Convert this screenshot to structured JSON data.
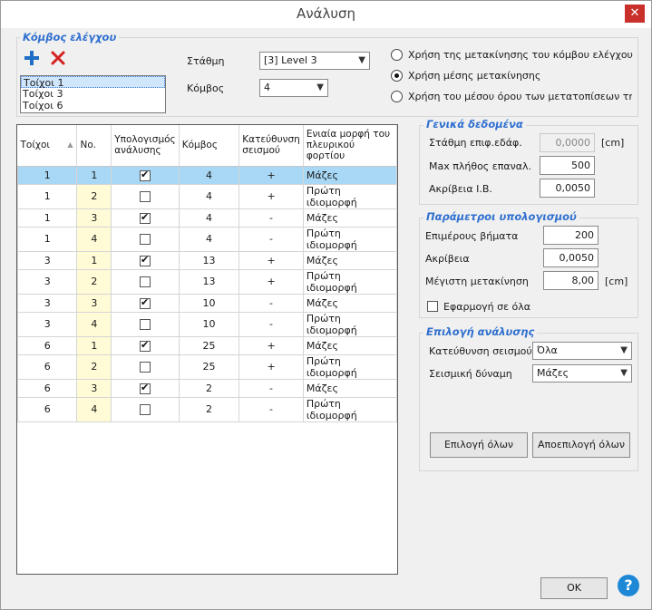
{
  "window": {
    "title": "Ανάλυση",
    "close_glyph": "✕"
  },
  "control_node": {
    "title": "Κόμβος ελέγχου",
    "add_icon": "plus-icon",
    "delete_icon": "x-icon",
    "list": [
      "Τοίχοι 1",
      "Τοίχοι 3",
      "Τοίχοι 6"
    ],
    "level_label": "Στάθμη",
    "level_value": "[3]   Level 3",
    "node_label": "Κόμβος",
    "node_value": "4",
    "radio_options": [
      {
        "label": "Χρήση της μετακίνησης του κόμβου ελέγχου",
        "checked": false
      },
      {
        "label": "Χρήση μέσης μετακίνησης",
        "checked": true
      },
      {
        "label": "Χρήση του μέσου όρου των μετατοπίσεων της στάθμ",
        "checked": false
      }
    ]
  },
  "table": {
    "headers": [
      "Τοίχοι",
      "No.",
      "Υπολογισμός ανάλυσης",
      "Κόμβος",
      "Κατεύθυνση σεισμού",
      "Ενιαία μορφή του πλευρικού φορτίου"
    ],
    "sort_glyph": "▲",
    "rows": [
      {
        "walls": "1",
        "no": "1",
        "calc": true,
        "node": "4",
        "dir": "+",
        "form": "Μάζες"
      },
      {
        "walls": "1",
        "no": "2",
        "calc": false,
        "node": "4",
        "dir": "+",
        "form": "Πρώτη ιδιομορφή"
      },
      {
        "walls": "1",
        "no": "3",
        "calc": true,
        "node": "4",
        "dir": "-",
        "form": "Μάζες"
      },
      {
        "walls": "1",
        "no": "4",
        "calc": false,
        "node": "4",
        "dir": "-",
        "form": "Πρώτη ιδιομορφή"
      },
      {
        "walls": "3",
        "no": "1",
        "calc": true,
        "node": "13",
        "dir": "+",
        "form": "Μάζες"
      },
      {
        "walls": "3",
        "no": "2",
        "calc": false,
        "node": "13",
        "dir": "+",
        "form": "Πρώτη ιδιομορφή"
      },
      {
        "walls": "3",
        "no": "3",
        "calc": true,
        "node": "10",
        "dir": "-",
        "form": "Μάζες"
      },
      {
        "walls": "3",
        "no": "4",
        "calc": false,
        "node": "10",
        "dir": "-",
        "form": "Πρώτη ιδιομορφή"
      },
      {
        "walls": "6",
        "no": "1",
        "calc": true,
        "node": "25",
        "dir": "+",
        "form": "Μάζες"
      },
      {
        "walls": "6",
        "no": "2",
        "calc": false,
        "node": "25",
        "dir": "+",
        "form": "Πρώτη ιδιομορφή"
      },
      {
        "walls": "6",
        "no": "3",
        "calc": true,
        "node": "2",
        "dir": "-",
        "form": "Μάζες"
      },
      {
        "walls": "6",
        "no": "4",
        "calc": false,
        "node": "2",
        "dir": "-",
        "form": "Πρώτη ιδιομορφή"
      }
    ]
  },
  "general": {
    "title": "Γενικά δεδομένα",
    "ground_level_label": "Στάθμη επιφ.εδάφ.",
    "ground_level_value": "0,0000",
    "ground_level_unit": "[cm]",
    "max_iter_label": "Max πλήθος επαναλ.",
    "max_iter_value": "500",
    "accuracy_label": "Ακρίβεια Ι.Β.",
    "accuracy_value": "0,0050"
  },
  "calc_params": {
    "title": "Παράμετροι υπολογισμού",
    "steps_label": "Επιμέρους βήματα",
    "steps_value": "200",
    "accuracy_label": "Ακρίβεια",
    "accuracy_value": "0,0050",
    "max_disp_label": "Μέγιστη μετακίνηση",
    "max_disp_value": "8,00",
    "max_disp_unit": "[cm]",
    "apply_all_label": "Εφαρμογή σε όλα"
  },
  "analysis_select": {
    "title": "Επιλογή ανάλυσης",
    "direction_label": "Κατεύθυνση σεισμού",
    "direction_value": "Όλα",
    "force_label": "Σεισμική δύναμη",
    "force_value": "Μάζες",
    "select_all": "Επιλογή όλων",
    "deselect_all": "Αποεπιλογή όλων"
  },
  "footer": {
    "ok": "OK",
    "help": "?"
  }
}
